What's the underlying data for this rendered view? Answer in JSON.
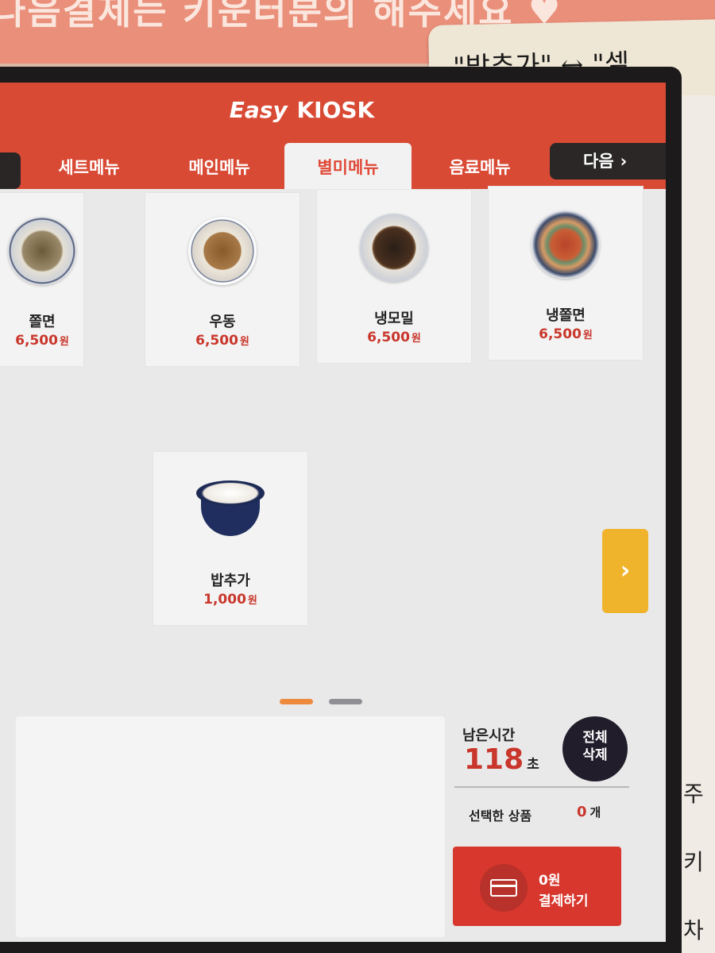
{
  "surroundings": {
    "banner_text": "다음결제는 키운터분의 해주세요 ♥",
    "sticky_note_text": "\"밥추가\" ↔ \"셀",
    "wall_marks": [
      "주",
      "키",
      "차"
    ]
  },
  "header": {
    "brand_prefix": "Easy",
    "brand_suffix": "KIOSK",
    "tabs": [
      {
        "label": "세트메뉴",
        "active": false
      },
      {
        "label": "메인메뉴",
        "active": false
      },
      {
        "label": "별미메뉴",
        "active": true
      },
      {
        "label": "음료메뉴",
        "active": false
      }
    ],
    "next_label": "다음",
    "next_chevron": "›"
  },
  "menu": {
    "items": [
      {
        "name": "쫄면",
        "price": "6,500",
        "currency": "원",
        "icon": "noodle-bowl-icon"
      },
      {
        "name": "우동",
        "price": "6,500",
        "currency": "원",
        "icon": "noodle-bowl-icon"
      },
      {
        "name": "냉모밀",
        "price": "6,500",
        "currency": "원",
        "icon": "noodle-bowl-icon"
      },
      {
        "name": "냉쫄면",
        "price": "6,500",
        "currency": "원",
        "icon": "noodle-bowl-icon"
      },
      {
        "name": "밥추가",
        "price": "1,000",
        "currency": "원",
        "icon": "rice-bowl-icon"
      }
    ],
    "next_page_arrow": "›",
    "pagination": {
      "current_page": 1,
      "total_pages": 2
    }
  },
  "status": {
    "remaining_label": "남은시간",
    "remaining_value": "118",
    "remaining_unit": "초",
    "clear_line1": "전체",
    "clear_line2": "삭제",
    "selected_label": "선택한 상품",
    "selected_count": "0",
    "selected_unit": "개",
    "pay_amount": "0원",
    "pay_label": "결제하기"
  },
  "colors": {
    "header": "#d94a35",
    "price": "#c9362b",
    "page_arrow": "#f0b32c",
    "pay_button": "#d7372d"
  }
}
